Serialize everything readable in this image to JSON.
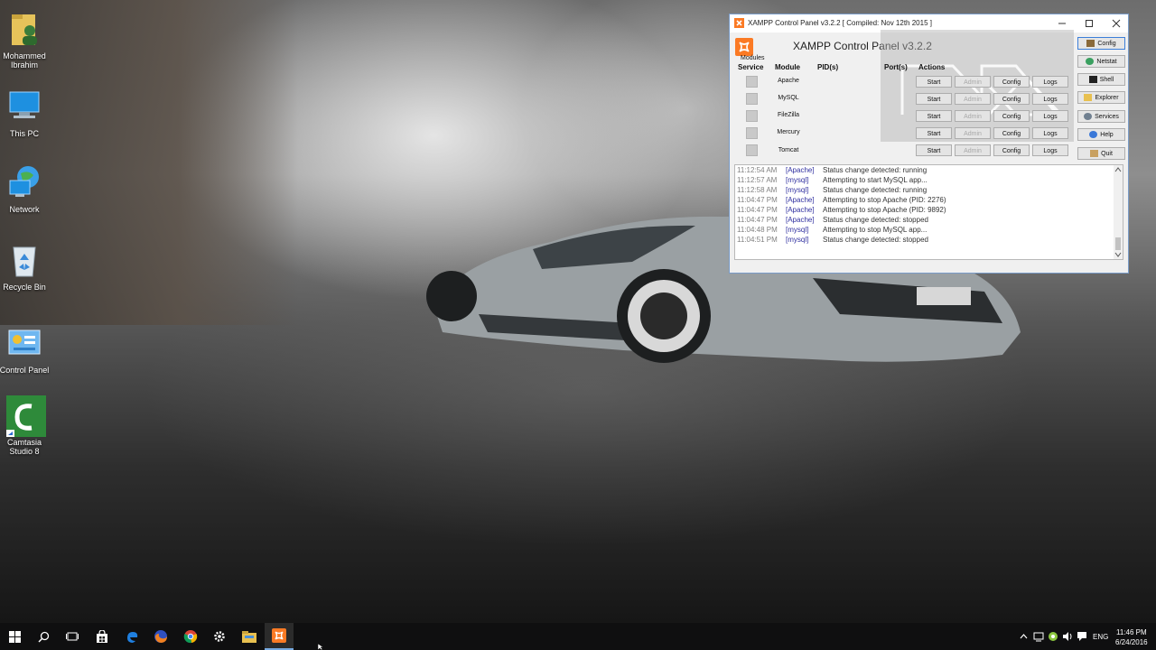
{
  "desktop": {
    "icons": [
      {
        "label": "Mohammed Ibrahim"
      },
      {
        "label": "This PC"
      },
      {
        "label": "Network"
      },
      {
        "label": "Recycle Bin"
      },
      {
        "label": "Control Panel"
      },
      {
        "label": "Camtasia Studio 8"
      }
    ]
  },
  "xampp": {
    "window_title": "XAMPP Control Panel v3.2.2   [ Compiled: Nov 12th 2015 ]",
    "header_title": "XAMPP Control Panel v3.2.2",
    "modules_label": "Modules",
    "columns": {
      "service": "Service",
      "module": "Module",
      "pids": "PID(s)",
      "ports": "Port(s)",
      "actions": "Actions"
    },
    "modules": [
      {
        "name": "Apache",
        "start": "Start",
        "admin": "Admin",
        "config": "Config",
        "logs": "Logs"
      },
      {
        "name": "MySQL",
        "start": "Start",
        "admin": "Admin",
        "config": "Config",
        "logs": "Logs"
      },
      {
        "name": "FileZilla",
        "start": "Start",
        "admin": "Admin",
        "config": "Config",
        "logs": "Logs"
      },
      {
        "name": "Mercury",
        "start": "Start",
        "admin": "Admin",
        "config": "Config",
        "logs": "Logs"
      },
      {
        "name": "Tomcat",
        "start": "Start",
        "admin": "Admin",
        "config": "Config",
        "logs": "Logs"
      }
    ],
    "side_buttons": [
      "Config",
      "Netstat",
      "Shell",
      "Explorer",
      "Services",
      "Help",
      "Quit"
    ],
    "log": [
      {
        "time": "11:12:54 AM",
        "module": "[Apache]",
        "message": "Status change detected: running"
      },
      {
        "time": "11:12:57 AM",
        "module": "[mysql]",
        "message": "Attempting to start MySQL app..."
      },
      {
        "time": "11:12:58 AM",
        "module": "[mysql]",
        "message": "Status change detected: running"
      },
      {
        "time": "11:04:47 PM",
        "module": "[Apache]",
        "message": "Attempting to stop Apache (PID: 2276)"
      },
      {
        "time": "11:04:47 PM",
        "module": "[Apache]",
        "message": "Attempting to stop Apache (PID: 9892)"
      },
      {
        "time": "11:04:47 PM",
        "module": "[Apache]",
        "message": "Status change detected: stopped"
      },
      {
        "time": "11:04:48 PM",
        "module": "[mysql]",
        "message": "Attempting to stop MySQL app..."
      },
      {
        "time": "11:04:51 PM",
        "module": "[mysql]",
        "message": "Status change detected: stopped"
      }
    ]
  },
  "taskbar": {
    "tray": {
      "language": "ENG",
      "time": "11:46 PM",
      "date": "6/24/2016"
    }
  },
  "colors": {
    "xampp_orange": "#fb7a24",
    "taskbar_bg": "#0f0f10",
    "log_module": "#3030a0",
    "log_time": "#808080"
  }
}
